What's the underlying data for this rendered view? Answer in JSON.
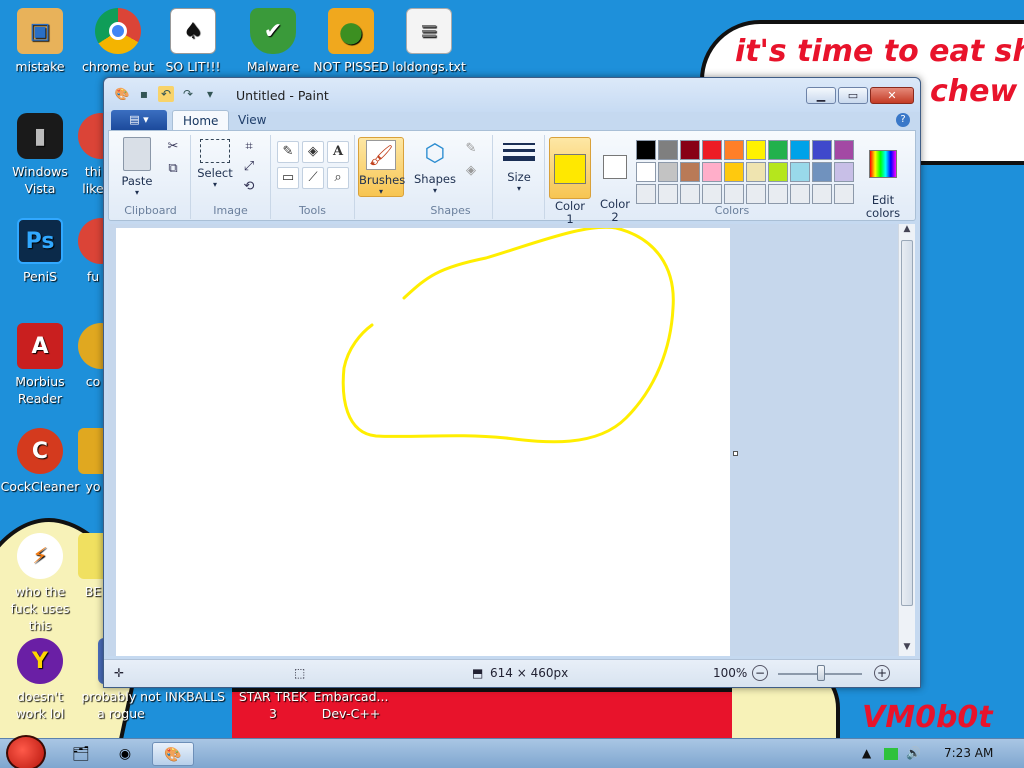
{
  "wallpaper": {
    "bubble_line1": "it's time to eat shit",
    "bubble_line2": "chew",
    "signature": "VM0b0t"
  },
  "desktop_icons": [
    {
      "label": "mistake",
      "icon": "folder-icon"
    },
    {
      "label": "chrome but no",
      "icon": "chrome-icon"
    },
    {
      "label": "SO LIT!!!",
      "icon": "solitaire-icon"
    },
    {
      "label": "Malware",
      "icon": "shield-icon"
    },
    {
      "label": "NOT PISSED",
      "icon": "angry-pig-icon"
    },
    {
      "label": "loldongs.txt",
      "icon": "text-file-icon"
    },
    {
      "label": "Windows Vista",
      "icon": "trash-icon"
    },
    {
      "label": "PeniS",
      "icon": "photoshop-icon"
    },
    {
      "label": "Morbius Reader",
      "icon": "pdf-icon"
    },
    {
      "label": "CockCleaner",
      "icon": "ccleaner-icon"
    },
    {
      "label": "who the fuck uses this",
      "icon": "winamp-icon"
    },
    {
      "label": "doesn't work lol",
      "icon": "yahoo-icon"
    },
    {
      "label": "probably not a rogue",
      "icon": "shield-icon"
    },
    {
      "label": "INKBALLS",
      "icon": "game-icon"
    },
    {
      "label": "STAR TREK 3",
      "icon": "game-icon"
    },
    {
      "label": "Embarcad... Dev-C++",
      "icon": "ide-icon"
    },
    {
      "label": "thi like",
      "icon": "chrome-icon"
    },
    {
      "label": "fu",
      "icon": "chrome-icon"
    },
    {
      "label": "co",
      "icon": "app-icon"
    },
    {
      "label": "yo",
      "icon": "app-icon"
    },
    {
      "label": "BE",
      "icon": "app-icon"
    }
  ],
  "paint": {
    "title": "Untitled - Paint",
    "menu_label": "▤ ▾",
    "tabs": [
      {
        "label": "Home"
      },
      {
        "label": "View"
      }
    ],
    "groups": {
      "clipboard": "Clipboard",
      "image": "Image",
      "tools": "Tools",
      "shapes": "Shapes",
      "colors": "Colors"
    },
    "buttons": {
      "paste": "Paste",
      "select": "Select",
      "brushes": "Brushes",
      "shapes": "Shapes",
      "size": "Size",
      "color1": "Color\n1",
      "color2": "Color\n2",
      "edit_colors": "Edit\ncolors"
    },
    "color1_value": "#ffe800",
    "color2_value": "#ffffff",
    "palette": [
      "#000000",
      "#7f7f7f",
      "#880015",
      "#ed1c24",
      "#ff7f27",
      "#fff200",
      "#22b14c",
      "#00a2e8",
      "#3f48cc",
      "#a349a4",
      "#ffffff",
      "#c3c3c3",
      "#b97a57",
      "#ffaec9",
      "#ffc90e",
      "#efe4b0",
      "#b5e61d",
      "#99d9ea",
      "#7092be",
      "#c8bfe7",
      "#e8ecf1",
      "#e8ecf1",
      "#e8ecf1",
      "#e8ecf1",
      "#e8ecf1",
      "#e8ecf1",
      "#e8ecf1",
      "#e8ecf1",
      "#e8ecf1",
      "#e8ecf1"
    ],
    "stroke_color": "#ffee00",
    "status": {
      "canvas_size": "614 × 460px",
      "zoom": "100%"
    }
  },
  "taskbar": {
    "time": "7:23 AM"
  }
}
